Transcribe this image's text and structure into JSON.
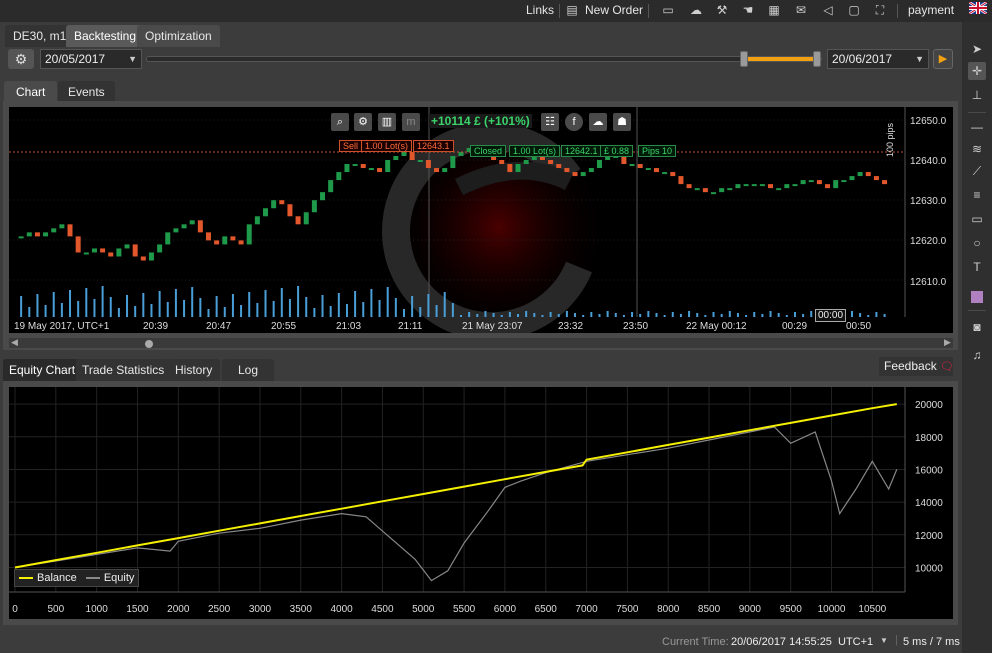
{
  "topbar": {
    "links_label": "Links",
    "new_order_label": "New Order",
    "user_label": "payment"
  },
  "main_tabs": [
    {
      "label": "DE30, m1"
    },
    {
      "label": "Backtesting"
    },
    {
      "label": "Optimization"
    }
  ],
  "backtest": {
    "start_date": "20/05/2017",
    "end_date": "20/06/2017",
    "range_start_fraction": 0.89,
    "range_end_fraction": 1.0
  },
  "chart_tabs": [
    {
      "label": "Chart"
    },
    {
      "label": "Events"
    }
  ],
  "price_chart": {
    "pnl_label": "+10114 £ (+101%)",
    "time_labels": [
      "19 May 2017, UTC+1",
      "20:39",
      "20:47",
      "20:55",
      "21:03",
      "21:11",
      "21 May 23:07",
      "23:32",
      "23:50",
      "22 May 00:12",
      "00:29",
      "00:50"
    ],
    "price_labels": [
      "12650.0",
      "12640.0",
      "12630.0",
      "12620.0",
      "12610.0"
    ],
    "cursor_time": "00:00",
    "pips_label": "100 pips",
    "sell_trade": {
      "side": "Sell",
      "lots": "1.00 Lot(s)",
      "price": "12643.1"
    },
    "closed_trade": {
      "status": "Closed",
      "lots": "1.00 Lot(s)",
      "price": "12642.1",
      "profit": "£ 0.88",
      "pips": "Pips 10"
    }
  },
  "bottom_tabs": [
    {
      "label": "Equity Chart"
    },
    {
      "label": "Trade Statistics"
    },
    {
      "label": "History"
    },
    {
      "label": "Log"
    }
  ],
  "feedback_label": "Feedback",
  "chart_data": {
    "type": "line",
    "title": "",
    "xlabel": "",
    "ylabel": "",
    "xlim": [
      0,
      10900
    ],
    "ylim": [
      8500,
      20800
    ],
    "x_ticks": [
      "0",
      "500",
      "1000",
      "1500",
      "2000",
      "2500",
      "3000",
      "3500",
      "4000",
      "4500",
      "5000",
      "5500",
      "6000",
      "6500",
      "7000",
      "7500",
      "8000",
      "8500",
      "9000",
      "9500",
      "10000",
      "10500"
    ],
    "y_ticks": [
      "20000",
      "18000",
      "16000",
      "14000",
      "12000",
      "10000"
    ],
    "legend_position": "bottom-left",
    "grid": true,
    "series": [
      {
        "name": "Balance",
        "color": "#f5f000",
        "x": [
          0,
          500,
          1000,
          1500,
          2000,
          2500,
          3000,
          3500,
          4000,
          4500,
          5000,
          5500,
          6000,
          6500,
          6950,
          7000,
          7500,
          8000,
          8500,
          9000,
          9500,
          10000,
          10500,
          10800
        ],
        "y": [
          10000,
          10450,
          10900,
          11350,
          11800,
          12250,
          12700,
          13150,
          13600,
          14050,
          14500,
          14950,
          15400,
          15850,
          16250,
          16600,
          17050,
          17500,
          17950,
          18400,
          18850,
          19300,
          19750,
          20000
        ]
      },
      {
        "name": "Equity",
        "color": "#888888",
        "x": [
          0,
          500,
          1000,
          1500,
          1900,
          2000,
          2500,
          3000,
          3500,
          4000,
          4300,
          4600,
          4900,
          5100,
          5300,
          5500,
          5800,
          6000,
          6200,
          6500,
          7000,
          7500,
          8000,
          8500,
          9000,
          9300,
          9500,
          9800,
          10000,
          10100,
          10300,
          10500,
          10700,
          10800
        ],
        "y": [
          10000,
          10400,
          10800,
          11200,
          11000,
          11600,
          12100,
          12400,
          12900,
          13300,
          13100,
          11800,
          10500,
          9200,
          9800,
          11500,
          13500,
          14900,
          15300,
          15800,
          16500,
          16900,
          17300,
          17800,
          18300,
          18600,
          17600,
          18300,
          15300,
          13300,
          14800,
          16500,
          14800,
          16000
        ]
      }
    ]
  },
  "status": {
    "current_time_label": "Current Time:",
    "current_time_value": "20/06/2017 14:55:25",
    "timezone": "UTC+1",
    "latency": "5 ms / 7 ms"
  },
  "colors": {
    "accent": "#f0a010",
    "bull_candle": "#1f9a4a",
    "bear_candle": "#e2572b",
    "volume": "#4a9fd8"
  }
}
